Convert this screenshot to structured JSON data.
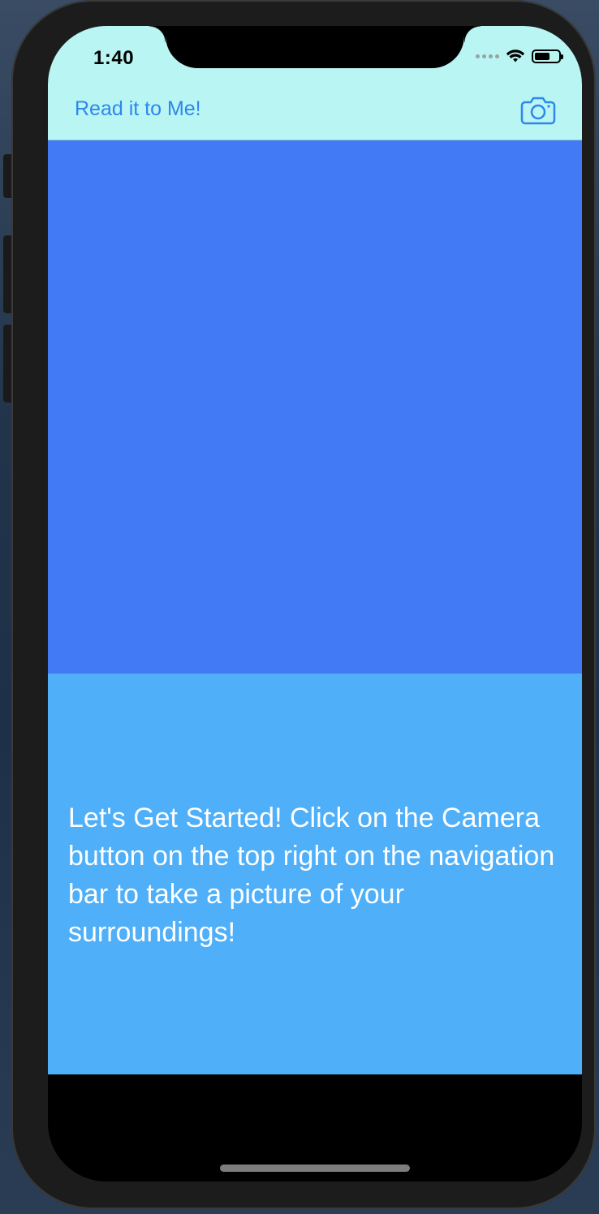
{
  "status_bar": {
    "time": "1:40"
  },
  "nav_bar": {
    "title": "Read it to Me!",
    "camera_icon": "camera-icon",
    "background_color": "#b8f5f3",
    "tint_color": "#2f86ee"
  },
  "image_area": {
    "background_color": "#4279f5"
  },
  "text_area": {
    "background_color": "#4faff9",
    "message": "Let's Get Started! Click on the Camera button on the top right on the navigation bar to take a picture of your surroundings!"
  }
}
